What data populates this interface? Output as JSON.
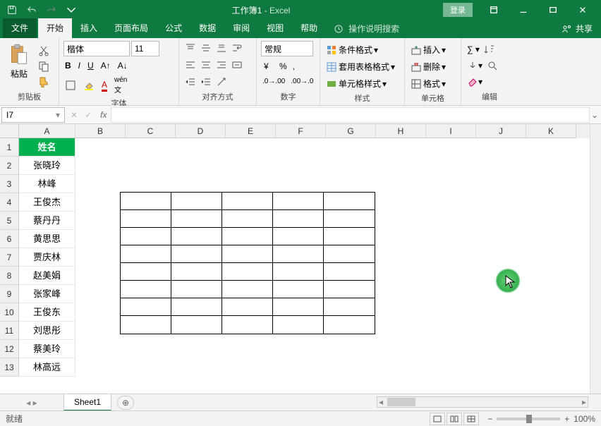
{
  "title": {
    "workbook": "工作簿1",
    "app": "Excel",
    "login": "登录"
  },
  "tabs": {
    "file": "文件",
    "home": "开始",
    "insert": "插入",
    "layout": "页面布局",
    "formulas": "公式",
    "data": "数据",
    "review": "审阅",
    "view": "视图",
    "help": "帮助",
    "tell": "操作说明搜索",
    "share": "共享"
  },
  "ribbon": {
    "clipboard": {
      "label": "剪贴板",
      "paste": "粘贴"
    },
    "font": {
      "label": "字体",
      "name": "楷体",
      "size": "11"
    },
    "align": {
      "label": "对齐方式"
    },
    "number": {
      "label": "数字",
      "format": "常规"
    },
    "styles": {
      "label": "样式",
      "cond": "条件格式",
      "table": "套用表格格式",
      "cell": "单元格样式"
    },
    "cells": {
      "label": "单元格",
      "insert": "插入",
      "delete": "删除",
      "format": "格式"
    },
    "editing": {
      "label": "编辑"
    }
  },
  "namebox": "I7",
  "columns": [
    "A",
    "B",
    "C",
    "D",
    "E",
    "F",
    "G",
    "H",
    "I",
    "J",
    "K"
  ],
  "rows": [
    "1",
    "2",
    "3",
    "4",
    "5",
    "6",
    "7",
    "8",
    "9",
    "10",
    "11",
    "12",
    "13"
  ],
  "colA": {
    "header": "姓名",
    "data": [
      "张晓玲",
      "林峰",
      "王俊杰",
      "蔡丹丹",
      "黄思思",
      "贾庆林",
      "赵美娟",
      "张家峰",
      "王俊东",
      "刘思彤",
      "蔡美玲",
      "林高远"
    ]
  },
  "floating_table": {
    "rows": 8,
    "cols": 5
  },
  "sheet": {
    "name": "Sheet1"
  },
  "status": {
    "ready": "就绪",
    "zoom": "100%"
  }
}
